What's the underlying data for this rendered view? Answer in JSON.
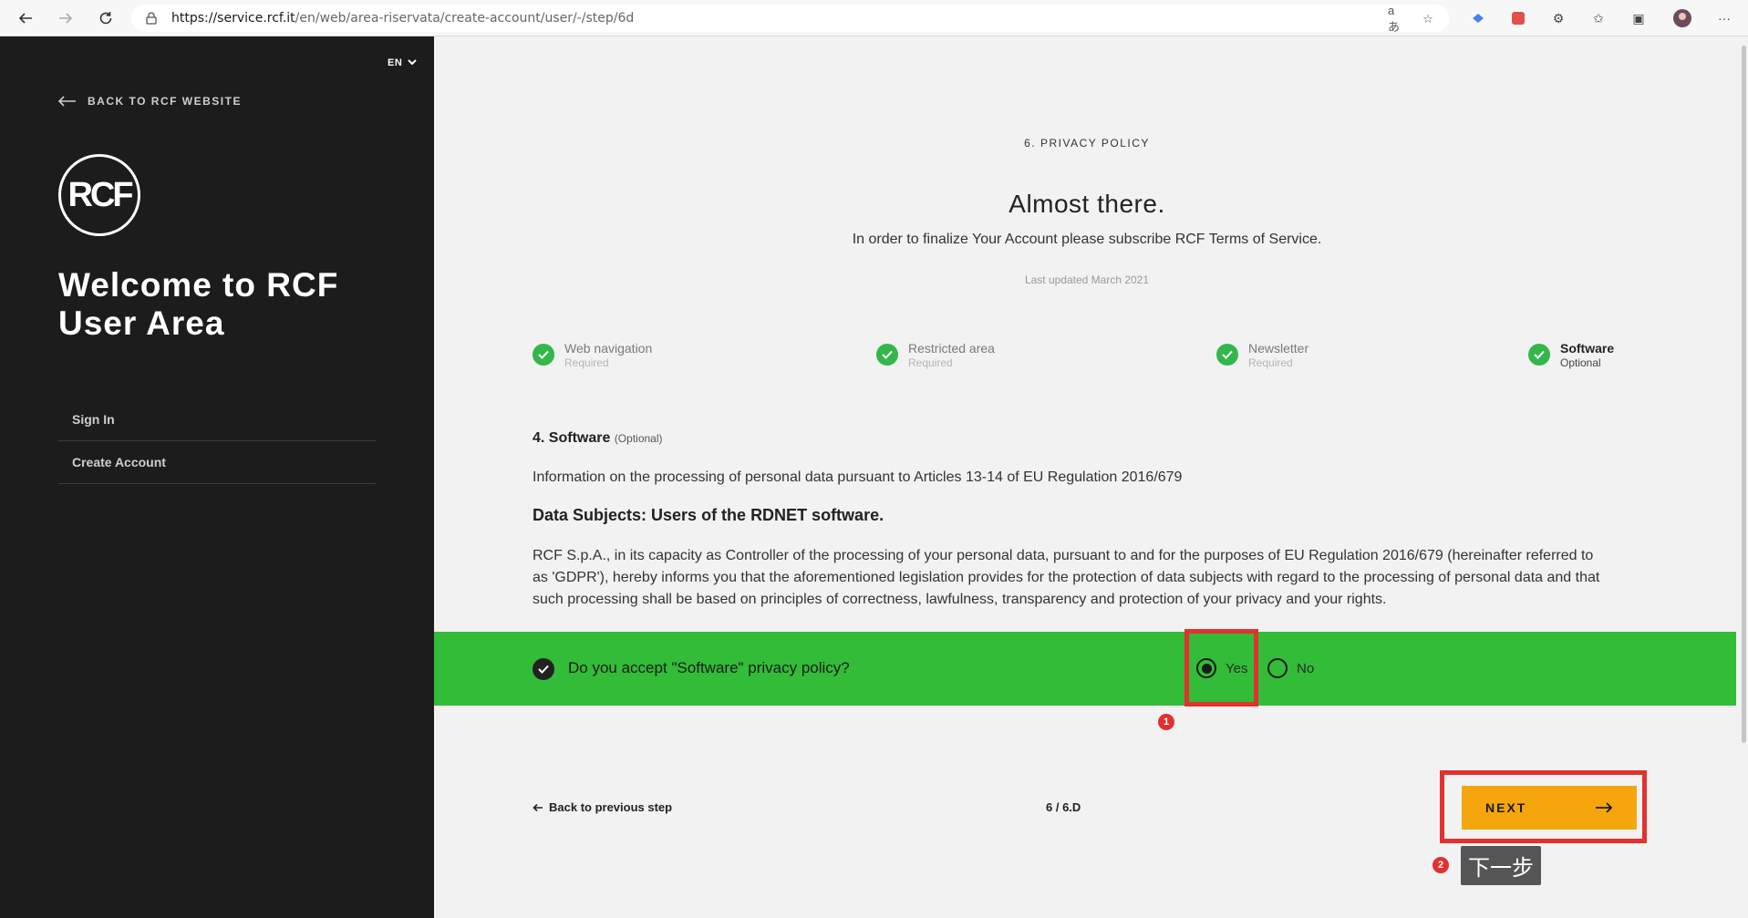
{
  "browser": {
    "url_domain": "https://service.rcf.it",
    "url_path": "/en/web/area-riservata/create-account/user/-/step/6d"
  },
  "sidebar": {
    "language": "EN",
    "back_link": "BACK TO RCF WEBSITE",
    "logo_text": "RCF",
    "welcome_line1": "Welcome to RCF",
    "welcome_line2": "User Area",
    "menu": [
      {
        "label": "Sign In"
      },
      {
        "label": "Create Account"
      }
    ]
  },
  "main": {
    "step_label": "6. PRIVACY POLICY",
    "heading": "Almost there.",
    "subheading": "In order to finalize Your Account please subscribe RCF Terms of Service.",
    "last_updated": "Last updated March 2021",
    "progress": [
      {
        "title": "Web navigation",
        "status": "Required"
      },
      {
        "title": "Restricted area",
        "status": "Required"
      },
      {
        "title": "Newsletter",
        "status": "Required"
      },
      {
        "title": "Software",
        "status": "Optional"
      }
    ],
    "policy": {
      "section_title": "4. Software",
      "section_tag": "(Optional)",
      "intro": "Information on the processing of personal data pursuant to Articles 13-14 of EU Regulation 2016/679",
      "subject": "Data Subjects: Users of the RDNET software.",
      "body": "RCF S.p.A., in its capacity as Controller of the processing of your personal data, pursuant to and for the purposes of EU Regulation 2016/679 (hereinafter referred to as 'GDPR'), hereby informs you that the aforementioned legislation provides for the protection of data subjects with regard to the processing of personal data and that such processing shall be based on principles of correctness, lawfulness, transparency and protection of your privacy and your rights."
    },
    "accept": {
      "question": "Do you accept \"Software\" privacy policy?",
      "yes_label": "Yes",
      "no_label": "No",
      "selected": "Yes"
    },
    "back_prev": "Back to previous step",
    "step_count": "6 / 6.D",
    "next_label": "NEXT"
  },
  "annotations": {
    "marker1": "1",
    "marker2": "2",
    "tooltip": "下一步",
    "color": "#e2312f"
  },
  "colors": {
    "sidebar_bg": "#1c1c1c",
    "accept_green": "#32bc38",
    "check_green": "#33b74a",
    "next_orange": "#f5a60c"
  }
}
